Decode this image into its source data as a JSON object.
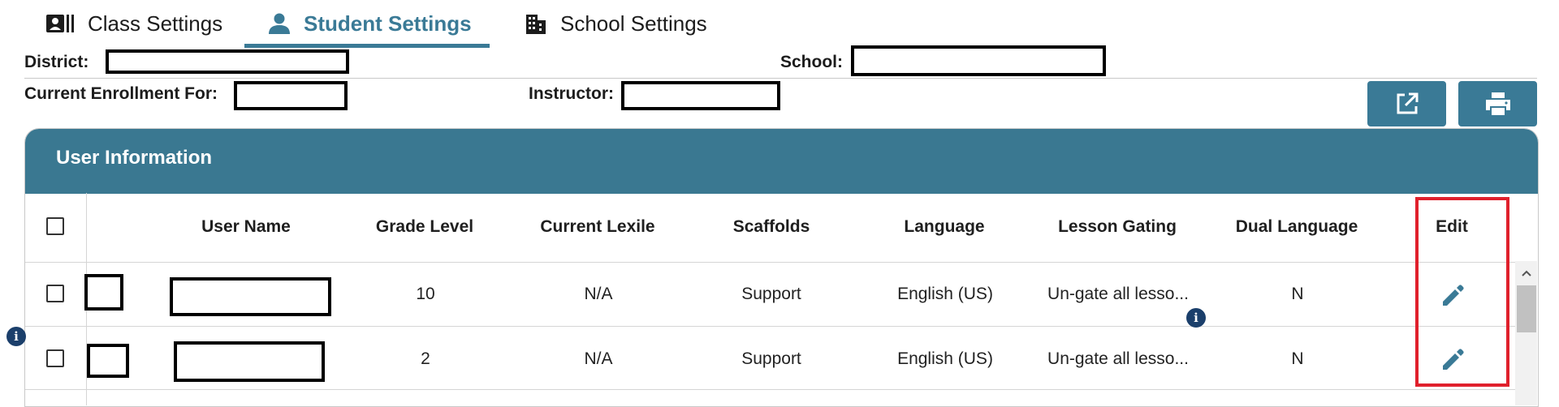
{
  "tabs": [
    {
      "label": "Class Settings",
      "icon": "contact-card-icon"
    },
    {
      "label": "Student Settings",
      "icon": "person-icon",
      "active": true
    },
    {
      "label": "School Settings",
      "icon": "building-icon"
    }
  ],
  "header": {
    "district_label": "District:",
    "school_label": "School:",
    "enrollment_label": "Current Enrollment For:",
    "instructor_label": "Instructor:"
  },
  "actions": {
    "export_icon": "external-link-icon",
    "print_icon": "printer-icon"
  },
  "panel": {
    "title": "User Information",
    "columns": [
      "User Name",
      "Grade Level",
      "Current Lexile",
      "Scaffolds",
      "Language",
      "Lesson Gating",
      "Dual Language",
      "Edit"
    ]
  },
  "rows": [
    {
      "grade": "10",
      "lexile": "N/A",
      "scaffolds": "Support",
      "language": "English (US)",
      "gating": "Un-gate all lesso...",
      "dual": "N"
    },
    {
      "grade": "2",
      "lexile": "N/A",
      "scaffolds": "Support",
      "language": "English (US)",
      "gating": "Un-gate all lesso...",
      "dual": "N"
    }
  ],
  "colors": {
    "accent": "#3a7a96",
    "panel_header": "#3a7891",
    "highlight": "#e0202c",
    "info": "#1b3f6b"
  }
}
